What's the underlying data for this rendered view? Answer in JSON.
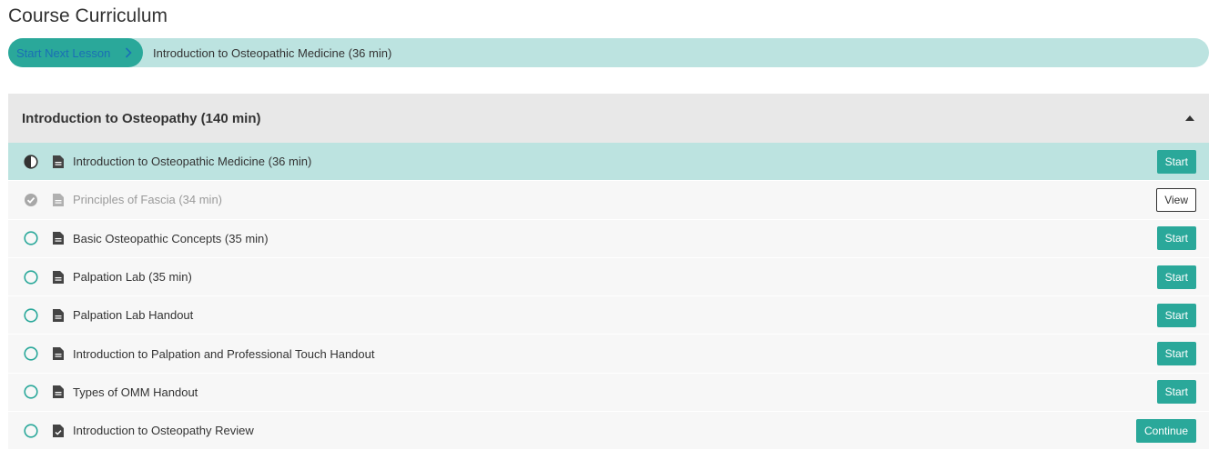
{
  "page": {
    "title": "Course Curriculum"
  },
  "next_lesson": {
    "button_label": "Start Next Lesson",
    "lesson_title": "Introduction to Osteopathic Medicine (36 min)"
  },
  "section": {
    "title": "Introduction to Osteopathy (140 min)",
    "expanded": true
  },
  "lessons": [
    {
      "title": "Introduction to Osteopathic Medicine (36 min)",
      "status": "in-progress",
      "type": "document",
      "action": "Start"
    },
    {
      "title": "Principles of Fascia (34 min)",
      "status": "completed",
      "type": "document",
      "action": "View"
    },
    {
      "title": "Basic Osteopathic Concepts (35 min)",
      "status": "not-started",
      "type": "document",
      "action": "Start"
    },
    {
      "title": "Palpation Lab (35 min)",
      "status": "not-started",
      "type": "document",
      "action": "Start"
    },
    {
      "title": "Palpation Lab Handout",
      "status": "not-started",
      "type": "document",
      "action": "Start"
    },
    {
      "title": "Introduction to Palpation and Professional Touch Handout",
      "status": "not-started",
      "type": "document",
      "action": "Start"
    },
    {
      "title": "Types of OMM Handout",
      "status": "not-started",
      "type": "document",
      "action": "Start"
    },
    {
      "title": "Introduction to Osteopathy Review",
      "status": "not-started",
      "type": "quiz",
      "action": "Continue"
    }
  ],
  "colors": {
    "accent": "#2aa89a",
    "highlight": "#bce3e0",
    "link": "#1a6fb5",
    "header_bg": "#e8e8e8",
    "row_bg": "#f7f7f7"
  }
}
